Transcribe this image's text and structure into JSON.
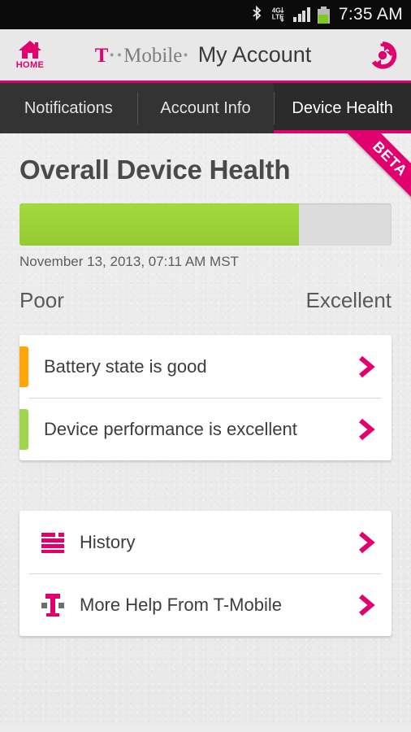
{
  "statusbar": {
    "time": "7:35 AM",
    "icons": [
      "bluetooth-icon",
      "lte-4g-icon",
      "signal-bars-icon",
      "battery-icon"
    ],
    "network_top": "4G",
    "network_bottom": "LTE"
  },
  "header": {
    "home_label": "HOME",
    "brand_t": "T",
    "brand_dots_left": "··",
    "brand_mobile": "Mobile",
    "brand_dot_right": "·",
    "app_title": "My Account",
    "refresh_icon": "refresh-icon"
  },
  "tabs": [
    {
      "label": "Notifications",
      "active": false
    },
    {
      "label": "Account Info",
      "active": false
    },
    {
      "label": "Device Health",
      "active": true
    }
  ],
  "ribbon": {
    "label": "BETA"
  },
  "main": {
    "title": "Overall Device Health",
    "meter_percent": 75,
    "timestamp": "November 13, 2013, 07:11 AM MST",
    "scale_low": "Poor",
    "scale_high": "Excellent"
  },
  "status_items": [
    {
      "label": "Battery state is good",
      "indicator_color": "#FFA60B"
    },
    {
      "label": "Device performance is excellent",
      "indicator_color": "#A0D64B"
    }
  ],
  "action_items": [
    {
      "label": "History",
      "icon": "history-list-icon"
    },
    {
      "label": "More Help From T-Mobile",
      "icon": "t-mobile-logo-icon"
    }
  ],
  "colors": {
    "magenta": "#E2006E",
    "green": "#9ACD32",
    "orange": "#FFA60B",
    "dark_tab": "#333333",
    "background": "#ECECEC"
  }
}
